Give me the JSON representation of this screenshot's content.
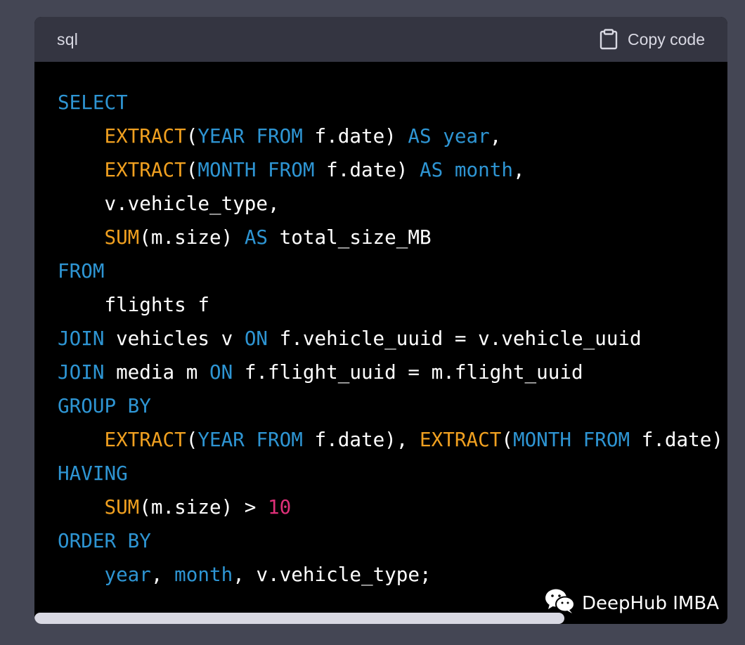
{
  "code_block": {
    "language": "sql",
    "copy_label": "Copy code",
    "lines": [
      [
        {
          "t": "SELECT",
          "c": "kw"
        }
      ],
      [
        {
          "t": "    "
        },
        {
          "t": "EXTRACT",
          "c": "fn"
        },
        {
          "t": "("
        },
        {
          "t": "YEAR FROM",
          "c": "kw"
        },
        {
          "t": " f.date) "
        },
        {
          "t": "AS",
          "c": "kw"
        },
        {
          "t": " "
        },
        {
          "t": "year",
          "c": "kw"
        },
        {
          "t": ","
        }
      ],
      [
        {
          "t": "    "
        },
        {
          "t": "EXTRACT",
          "c": "fn"
        },
        {
          "t": "("
        },
        {
          "t": "MONTH FROM",
          "c": "kw"
        },
        {
          "t": " f.date) "
        },
        {
          "t": "AS",
          "c": "kw"
        },
        {
          "t": " "
        },
        {
          "t": "month",
          "c": "kw"
        },
        {
          "t": ","
        }
      ],
      [
        {
          "t": "    v.vehicle_type,"
        }
      ],
      [
        {
          "t": "    "
        },
        {
          "t": "SUM",
          "c": "fn"
        },
        {
          "t": "(m.size) "
        },
        {
          "t": "AS",
          "c": "kw"
        },
        {
          "t": " total_size_MB"
        }
      ],
      [
        {
          "t": "FROM",
          "c": "kw"
        }
      ],
      [
        {
          "t": "    flights f"
        }
      ],
      [
        {
          "t": "JOIN",
          "c": "kw"
        },
        {
          "t": " vehicles v "
        },
        {
          "t": "ON",
          "c": "kw"
        },
        {
          "t": " f.vehicle_uuid = v.vehicle_uuid"
        }
      ],
      [
        {
          "t": "JOIN",
          "c": "kw"
        },
        {
          "t": " media m "
        },
        {
          "t": "ON",
          "c": "kw"
        },
        {
          "t": " f.flight_uuid = m.flight_uuid"
        }
      ],
      [
        {
          "t": "GROUP BY",
          "c": "kw"
        }
      ],
      [
        {
          "t": "    "
        },
        {
          "t": "EXTRACT",
          "c": "fn"
        },
        {
          "t": "("
        },
        {
          "t": "YEAR FROM",
          "c": "kw"
        },
        {
          "t": " f.date), "
        },
        {
          "t": "EXTRACT",
          "c": "fn"
        },
        {
          "t": "("
        },
        {
          "t": "MONTH FROM",
          "c": "kw"
        },
        {
          "t": " f.date)"
        }
      ],
      [
        {
          "t": "HAVING",
          "c": "kw"
        }
      ],
      [
        {
          "t": "    "
        },
        {
          "t": "SUM",
          "c": "fn"
        },
        {
          "t": "(m.size) > "
        },
        {
          "t": "10",
          "c": "num"
        }
      ],
      [
        {
          "t": "ORDER BY",
          "c": "kw"
        }
      ],
      [
        {
          "t": "    "
        },
        {
          "t": "year",
          "c": "kw"
        },
        {
          "t": ", "
        },
        {
          "t": "month",
          "c": "kw"
        },
        {
          "t": ", v.vehicle_type;"
        }
      ]
    ]
  },
  "watermark": {
    "text": "DeepHub IMBA",
    "icon": "wechat-icon"
  },
  "colors": {
    "keyword": "#2e95d3",
    "function": "#f0a020",
    "number": "#df3079",
    "plain": "#ffffff",
    "header_bg": "#343541",
    "page_bg": "#444654"
  }
}
